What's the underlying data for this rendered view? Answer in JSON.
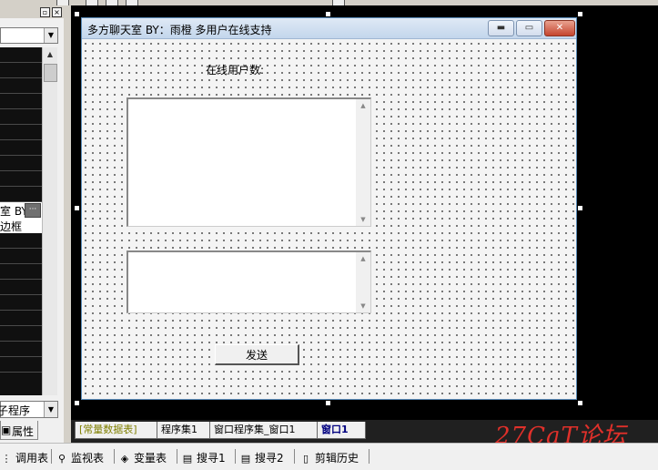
{
  "form": {
    "title": "多方聊天室 BY：雨橙 多用户在线支持",
    "online_label": "在线用户数:",
    "send_button": "发送"
  },
  "left_panel": {
    "row_text_1": "室 BY",
    "row_text_2": "边框",
    "combo_bottom_value": "子程序",
    "tab_label": "属性"
  },
  "tabs": [
    {
      "label": "[常量数据表]"
    },
    {
      "label": "程序集1"
    },
    {
      "label": "窗口程序集_窗口1"
    },
    {
      "label": "窗口1"
    }
  ],
  "bottom_toolbar": [
    {
      "label": "调用表",
      "icon": "call-table-icon"
    },
    {
      "label": "监视表",
      "icon": "magnifier-icon"
    },
    {
      "label": "变量表",
      "icon": "variable-icon"
    },
    {
      "label": "搜寻1",
      "icon": "search1-icon"
    },
    {
      "label": "搜寻2",
      "icon": "search2-icon"
    },
    {
      "label": "剪辑历史",
      "icon": "clip-history-icon"
    }
  ],
  "watermark": "27CaT论坛",
  "colors": {
    "titlebar": "#c3d6ec",
    "close_button": "#c5452f",
    "watermark": "#e0302a",
    "tab_const": "#808000",
    "tab_active": "#000080"
  }
}
